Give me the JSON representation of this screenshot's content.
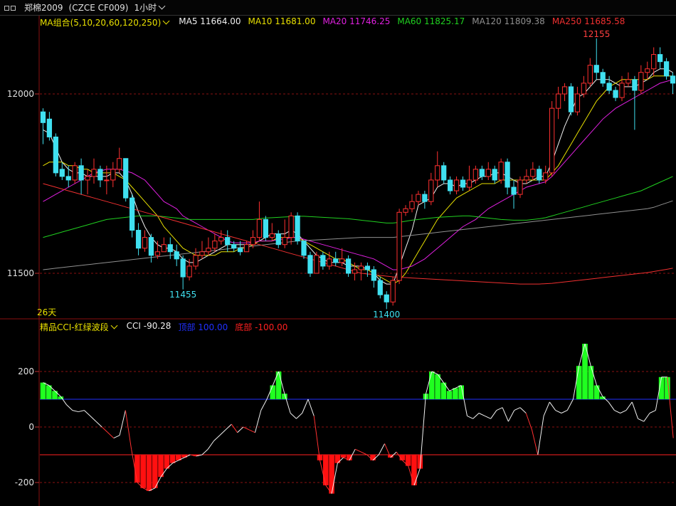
{
  "symbol": {
    "name": "郑棉2009",
    "code": "(CZCE CF009)",
    "period": "1小时"
  },
  "main_legend": {
    "group_label": "MA组合(5,10,20,60,120,250)",
    "items": [
      {
        "label": "MA5 11664.00",
        "color": "#f0f0f0"
      },
      {
        "label": "MA10 11681.00",
        "color": "#e8e000"
      },
      {
        "label": "MA20 11746.25",
        "color": "#e020e0"
      },
      {
        "label": "MA60 11825.17",
        "color": "#20d020"
      },
      {
        "label": "MA120 11809.38",
        "color": "#909090"
      },
      {
        "label": "MA250 11685.58",
        "color": "#f03030"
      }
    ]
  },
  "main_axis": {
    "labels": [
      "12000",
      "11500"
    ]
  },
  "annotations": {
    "high": "12155",
    "low1": "11455",
    "low2": "11400",
    "days": "26天"
  },
  "sub_legend": {
    "indicator_label": "精品CCI-红绿波段",
    "items": [
      {
        "label": "CCI -90.28",
        "color": "#f0f0f0"
      },
      {
        "label": "顶部 100.00",
        "color": "#2030ff"
      },
      {
        "label": "底部 -100.00",
        "color": "#ff2020"
      }
    ]
  },
  "sub_axis": {
    "labels": [
      "200",
      "0",
      "-200"
    ]
  },
  "colors": {
    "up": "#ff3030",
    "down": "#40e0f0",
    "grid": "#8a1010",
    "bg": "#000000"
  },
  "chart_data": {
    "type": "line",
    "candles": [
      [
        11950,
        11920,
        11960,
        11860
      ],
      [
        11930,
        11880,
        11950,
        11870
      ],
      [
        11880,
        11780,
        11890,
        11770
      ],
      [
        11790,
        11770,
        11810,
        11760
      ],
      [
        11770,
        11760,
        11800,
        11740
      ],
      [
        11760,
        11800,
        11810,
        11750
      ],
      [
        11800,
        11760,
        11820,
        11720
      ],
      [
        11760,
        11770,
        11790,
        11720
      ],
      [
        11770,
        11790,
        11820,
        11750
      ],
      [
        11790,
        11760,
        11800,
        11740
      ],
      [
        11760,
        11760,
        11800,
        11720
      ],
      [
        11760,
        11790,
        11810,
        11740
      ],
      [
        11790,
        11820,
        11850,
        11780
      ],
      [
        11820,
        11710,
        11820,
        11700
      ],
      [
        11710,
        11620,
        11720,
        11600
      ],
      [
        11620,
        11570,
        11640,
        11550
      ],
      [
        11570,
        11600,
        11620,
        11560
      ],
      [
        11600,
        11550,
        11610,
        11530
      ],
      [
        11550,
        11560,
        11590,
        11540
      ],
      [
        11560,
        11580,
        11600,
        11560
      ],
      [
        11580,
        11560,
        11600,
        11540
      ],
      [
        11560,
        11540,
        11580,
        11520
      ],
      [
        11540,
        11490,
        11550,
        11455
      ],
      [
        11490,
        11520,
        11540,
        11480
      ],
      [
        11520,
        11550,
        11570,
        11510
      ],
      [
        11550,
        11560,
        11590,
        11540
      ],
      [
        11560,
        11570,
        11600,
        11550
      ],
      [
        11570,
        11590,
        11610,
        11560
      ],
      [
        11590,
        11600,
        11620,
        11580
      ],
      [
        11600,
        11580,
        11620,
        11560
      ],
      [
        11580,
        11570,
        11590,
        11560
      ],
      [
        11570,
        11560,
        11590,
        11550
      ],
      [
        11560,
        11580,
        11590,
        11560
      ],
      [
        11580,
        11600,
        11620,
        11570
      ],
      [
        11600,
        11650,
        11700,
        11590
      ],
      [
        11650,
        11600,
        11660,
        11590
      ],
      [
        11600,
        11610,
        11640,
        11590
      ],
      [
        11610,
        11580,
        11620,
        11570
      ],
      [
        11580,
        11600,
        11650,
        11570
      ],
      [
        11600,
        11660,
        11670,
        11580
      ],
      [
        11660,
        11590,
        11670,
        11580
      ],
      [
        11590,
        11550,
        11590,
        11540
      ],
      [
        11550,
        11500,
        11560,
        11490
      ],
      [
        11500,
        11550,
        11560,
        11500
      ],
      [
        11550,
        11520,
        11560,
        11510
      ],
      [
        11520,
        11540,
        11560,
        11510
      ],
      [
        11540,
        11530,
        11560,
        11520
      ],
      [
        11530,
        11540,
        11570,
        11520
      ],
      [
        11540,
        11500,
        11550,
        11490
      ],
      [
        11500,
        11510,
        11530,
        11480
      ],
      [
        11510,
        11520,
        11530,
        11480
      ],
      [
        11520,
        11510,
        11530,
        11490
      ],
      [
        11510,
        11480,
        11520,
        11460
      ],
      [
        11480,
        11440,
        11490,
        11430
      ],
      [
        11440,
        11420,
        11450,
        11400
      ],
      [
        11420,
        11480,
        11490,
        11410
      ],
      [
        11480,
        11670,
        11680,
        11470
      ],
      [
        11670,
        11680,
        11690,
        11660
      ],
      [
        11680,
        11700,
        11720,
        11670
      ],
      [
        11700,
        11720,
        11730,
        11690
      ],
      [
        11720,
        11700,
        11730,
        11680
      ],
      [
        11700,
        11760,
        11780,
        11690
      ],
      [
        11760,
        11800,
        11840,
        11740
      ],
      [
        11800,
        11760,
        11810,
        11750
      ],
      [
        11760,
        11730,
        11770,
        11720
      ],
      [
        11730,
        11760,
        11770,
        11720
      ],
      [
        11760,
        11740,
        11770,
        11730
      ],
      [
        11740,
        11760,
        11800,
        11730
      ],
      [
        11760,
        11790,
        11800,
        11750
      ],
      [
        11790,
        11770,
        11800,
        11760
      ],
      [
        11770,
        11790,
        11810,
        11760
      ],
      [
        11790,
        11760,
        11800,
        11750
      ],
      [
        11760,
        11810,
        11820,
        11750
      ],
      [
        11810,
        11740,
        11820,
        11720
      ],
      [
        11740,
        11720,
        11760,
        11680
      ],
      [
        11720,
        11760,
        11770,
        11710
      ],
      [
        11760,
        11770,
        11790,
        11750
      ],
      [
        11770,
        11790,
        11810,
        11760
      ],
      [
        11790,
        11760,
        11800,
        11750
      ],
      [
        11760,
        11780,
        11800,
        11750
      ],
      [
        11780,
        11960,
        11980,
        11770
      ],
      [
        11960,
        12000,
        12020,
        11930
      ],
      [
        12000,
        12020,
        12030,
        11980
      ],
      [
        12020,
        11950,
        12030,
        11940
      ],
      [
        11950,
        12000,
        12020,
        11940
      ],
      [
        12000,
        12030,
        12050,
        11990
      ],
      [
        12030,
        12080,
        12100,
        12020
      ],
      [
        12080,
        12060,
        12155,
        12040
      ],
      [
        12060,
        12030,
        12070,
        12020
      ],
      [
        12030,
        12010,
        12050,
        12000
      ],
      [
        12010,
        11990,
        12020,
        11980
      ],
      [
        11990,
        12030,
        12050,
        11980
      ],
      [
        12030,
        12040,
        12060,
        12020
      ],
      [
        12040,
        12010,
        12050,
        11900
      ],
      [
        12010,
        12060,
        12080,
        12000
      ],
      [
        12060,
        12070,
        12090,
        12040
      ],
      [
        12070,
        12110,
        12130,
        12050
      ],
      [
        12110,
        12090,
        12130,
        12070
      ],
      [
        12090,
        12050,
        12100,
        12040
      ],
      [
        12050,
        12030,
        12060,
        12000
      ]
    ],
    "ma": {
      "MA5": [
        11900,
        11890,
        11850,
        11810,
        11790,
        11780,
        11780,
        11770,
        11770,
        11770,
        11770,
        11780,
        11780,
        11760,
        11720,
        11670,
        11630,
        11600,
        11580,
        11570,
        11570,
        11560,
        11540,
        11530,
        11530,
        11540,
        11550,
        11560,
        11570,
        11580,
        11580,
        11580,
        11580,
        11580,
        11590,
        11600,
        11610,
        11610,
        11610,
        11620,
        11610,
        11590,
        11570,
        11550,
        11540,
        11530,
        11530,
        11530,
        11520,
        11520,
        11520,
        11510,
        11500,
        11480,
        11470,
        11470,
        11520,
        11570,
        11620,
        11690,
        11700,
        11710,
        11740,
        11750,
        11750,
        11740,
        11750,
        11750,
        11760,
        11770,
        11770,
        11780,
        11780,
        11770,
        11760,
        11750,
        11750,
        11760,
        11770,
        11770,
        11810,
        11860,
        11910,
        11950,
        11990,
        12000,
        12020,
        12040,
        12040,
        12040,
        12030,
        12020,
        12020,
        12020,
        12030,
        12040,
        12060,
        12070,
        12070,
        12060
      ],
      "MA10": [
        11800,
        11810,
        11810,
        11810,
        11800,
        11800,
        11790,
        11790,
        11780,
        11780,
        11780,
        11780,
        11770,
        11760,
        11740,
        11720,
        11700,
        11680,
        11660,
        11630,
        11610,
        11590,
        11570,
        11560,
        11550,
        11550,
        11550,
        11550,
        11560,
        11560,
        11560,
        11570,
        11570,
        11580,
        11590,
        11590,
        11590,
        11600,
        11600,
        11600,
        11600,
        11590,
        11580,
        11570,
        11560,
        11550,
        11540,
        11540,
        11530,
        11520,
        11510,
        11510,
        11500,
        11490,
        11480,
        11470,
        11480,
        11500,
        11530,
        11560,
        11590,
        11620,
        11650,
        11670,
        11690,
        11710,
        11720,
        11730,
        11740,
        11750,
        11750,
        11750,
        11760,
        11760,
        11760,
        11760,
        11760,
        11760,
        11760,
        11760,
        11780,
        11800,
        11830,
        11860,
        11890,
        11920,
        11950,
        11980,
        12000,
        12020,
        12030,
        12040,
        12040,
        12040,
        12040,
        12040,
        12050,
        12050,
        12050,
        12050
      ],
      "MA20": [
        11700,
        11710,
        11720,
        11730,
        11740,
        11750,
        11760,
        11770,
        11780,
        11785,
        11790,
        11790,
        11790,
        11785,
        11780,
        11770,
        11760,
        11740,
        11720,
        11700,
        11690,
        11680,
        11660,
        11650,
        11640,
        11630,
        11620,
        11610,
        11600,
        11590,
        11585,
        11585,
        11585,
        11585,
        11590,
        11590,
        11590,
        11595,
        11595,
        11600,
        11600,
        11595,
        11590,
        11585,
        11580,
        11575,
        11570,
        11565,
        11560,
        11555,
        11550,
        11545,
        11540,
        11530,
        11520,
        11510,
        11510,
        11515,
        11520,
        11530,
        11540,
        11555,
        11570,
        11585,
        11600,
        11615,
        11630,
        11640,
        11650,
        11665,
        11680,
        11690,
        11700,
        11710,
        11720,
        11730,
        11740,
        11745,
        11750,
        11755,
        11770,
        11790,
        11810,
        11830,
        11850,
        11870,
        11890,
        11910,
        11930,
        11945,
        11960,
        11970,
        11980,
        11990,
        12000,
        12010,
        12020,
        12030,
        12035,
        12040
      ],
      "MA60": [
        11600,
        11605,
        11610,
        11615,
        11620,
        11625,
        11630,
        11635,
        11640,
        11645,
        11650,
        11652,
        11654,
        11656,
        11658,
        11660,
        11660,
        11660,
        11660,
        11658,
        11656,
        11654,
        11652,
        11650,
        11650,
        11650,
        11650,
        11650,
        11650,
        11650,
        11650,
        11650,
        11650,
        11650,
        11652,
        11654,
        11655,
        11656,
        11657,
        11658,
        11659,
        11659,
        11658,
        11657,
        11656,
        11655,
        11654,
        11653,
        11652,
        11650,
        11648,
        11646,
        11644,
        11642,
        11640,
        11640,
        11642,
        11645,
        11648,
        11650,
        11652,
        11654,
        11656,
        11657,
        11658,
        11659,
        11660,
        11660,
        11658,
        11656,
        11654,
        11652,
        11650,
        11649,
        11648,
        11648,
        11648,
        11650,
        11652,
        11655,
        11660,
        11665,
        11670,
        11675,
        11680,
        11685,
        11690,
        11695,
        11700,
        11705,
        11710,
        11715,
        11720,
        11725,
        11730,
        11738,
        11746,
        11754,
        11762,
        11770
      ],
      "MA120": [
        11510,
        11512,
        11514,
        11516,
        11518,
        11520,
        11522,
        11524,
        11526,
        11528,
        11530,
        11532,
        11534,
        11536,
        11538,
        11540,
        11542,
        11544,
        11546,
        11548,
        11550,
        11552,
        11554,
        11556,
        11558,
        11560,
        11562,
        11564,
        11566,
        11568,
        11570,
        11572,
        11574,
        11576,
        11578,
        11580,
        11582,
        11584,
        11586,
        11588,
        11590,
        11591,
        11592,
        11593,
        11594,
        11595,
        11596,
        11597,
        11598,
        11599,
        11600,
        11600,
        11600,
        11600,
        11600,
        11600,
        11602,
        11604,
        11606,
        11608,
        11610,
        11612,
        11614,
        11616,
        11618,
        11620,
        11622,
        11624,
        11626,
        11628,
        11630,
        11632,
        11634,
        11636,
        11638,
        11640,
        11642,
        11644,
        11646,
        11648,
        11650,
        11652,
        11654,
        11656,
        11658,
        11660,
        11662,
        11664,
        11666,
        11668,
        11670,
        11672,
        11674,
        11676,
        11678,
        11680,
        11684,
        11690,
        11696,
        11702
      ],
      "MA250": [
        11750,
        11745,
        11740,
        11735,
        11730,
        11725,
        11720,
        11715,
        11710,
        11705,
        11700,
        11695,
        11690,
        11685,
        11680,
        11675,
        11670,
        11665,
        11660,
        11655,
        11650,
        11645,
        11640,
        11635,
        11630,
        11625,
        11620,
        11615,
        11610,
        11605,
        11600,
        11595,
        11590,
        11585,
        11580,
        11575,
        11570,
        11565,
        11560,
        11555,
        11550,
        11545,
        11540,
        11535,
        11530,
        11525,
        11520,
        11515,
        11510,
        11505,
        11500,
        11498,
        11496,
        11494,
        11492,
        11490,
        11489,
        11488,
        11487,
        11486,
        11485,
        11484,
        11483,
        11482,
        11481,
        11480,
        11479,
        11478,
        11477,
        11476,
        11475,
        11474,
        11473,
        11472,
        11471,
        11470,
        11470,
        11470,
        11470,
        11471,
        11472,
        11474,
        11476,
        11478,
        11480,
        11482,
        11484,
        11486,
        11488,
        11490,
        11492,
        11494,
        11496,
        11498,
        11500,
        11502,
        11505,
        11508,
        11511,
        11514
      ]
    },
    "cci": [
      160,
      150,
      130,
      110,
      80,
      60,
      55,
      60,
      40,
      20,
      0,
      -20,
      -40,
      -30,
      60,
      -80,
      -200,
      -220,
      -230,
      -220,
      -180,
      -150,
      -130,
      -120,
      -110,
      -100,
      -105,
      -100,
      -80,
      -50,
      -30,
      -10,
      10,
      -20,
      0,
      -10,
      -20,
      60,
      100,
      150,
      200,
      120,
      50,
      30,
      50,
      100,
      40,
      -120,
      -210,
      -240,
      -130,
      -110,
      -120,
      -80,
      -90,
      -100,
      -120,
      -100,
      -60,
      -110,
      -90,
      -120,
      -140,
      -210,
      -150,
      120,
      200,
      190,
      160,
      130,
      140,
      150,
      40,
      30,
      50,
      40,
      30,
      60,
      70,
      20,
      60,
      70,
      50,
      -10,
      -100,
      40,
      90,
      60,
      50,
      60,
      100,
      220,
      300,
      220,
      150,
      110,
      90,
      60,
      50,
      60,
      90,
      30,
      20,
      50,
      60,
      180,
      180,
      -40
    ]
  }
}
